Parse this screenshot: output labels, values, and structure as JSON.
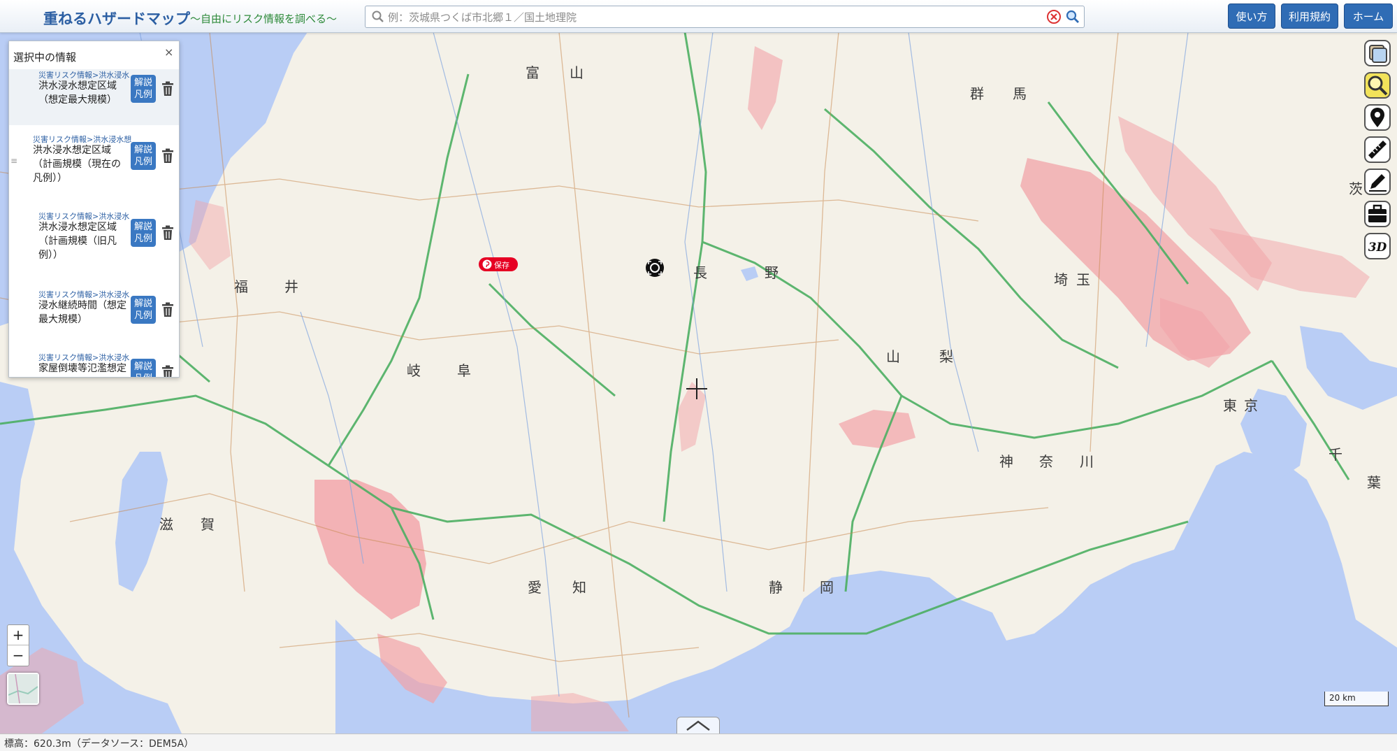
{
  "header": {
    "title": "重ねるハザードマップ",
    "subtitle": "〜自由にリスク情報を調べる〜",
    "search_placeholder": "例：茨城県つくば市北郷１／国土地理院",
    "buttons": [
      "使い方",
      "利用規約",
      "ホーム"
    ]
  },
  "panel": {
    "title": "選択中の情報",
    "close_label": "×",
    "legend_label_1": "解説",
    "legend_label_2": "凡例",
    "items": [
      {
        "path": "災害リスク情報>洪水浸水",
        "name_line1": "洪水浸水想定区域",
        "name_line2": "（想定最大規模）",
        "name_line3": ""
      },
      {
        "path": "災害リスク情報>洪水浸水想",
        "name_line1": "洪水浸水想定区域",
        "name_line2": "（計画規模（現在の",
        "name_line3": "凡例））"
      },
      {
        "path": "災害リスク情報>洪水浸水",
        "name_line1": "洪水浸水想定区域",
        "name_line2": "（計画規模（旧凡",
        "name_line3": "例））"
      },
      {
        "path": "災害リスク情報>洪水浸水",
        "name_line1": "浸水継続時間（想定",
        "name_line2": "最大規模）",
        "name_line3": ""
      },
      {
        "path": "災害リスク情報>洪水浸水",
        "name_line1": "家屋倒壊等氾濫想定",
        "name_line2": "",
        "name_line3": ""
      }
    ]
  },
  "map": {
    "save_label": "保存",
    "scale_label": "20 km",
    "status": "標高：620.3m（データソース：DEM5A）",
    "zoom_in": "+",
    "zoom_out": "−",
    "prefecture_labels": [
      "富",
      "山",
      "群",
      "馬",
      "福",
      "井",
      "岐",
      "阜",
      "長",
      "野",
      "山",
      "梨",
      "埼",
      "玉",
      "東",
      "京",
      "神",
      "奈",
      "川",
      "静",
      "岡",
      "愛",
      "知",
      "滋",
      "賀",
      "千",
      "葉",
      "茨"
    ]
  },
  "tools": [
    "layers-icon",
    "search-map-icon",
    "location-pin-icon",
    "ruler-icon",
    "pencil-icon",
    "toolbox-icon",
    "3d-icon"
  ]
}
